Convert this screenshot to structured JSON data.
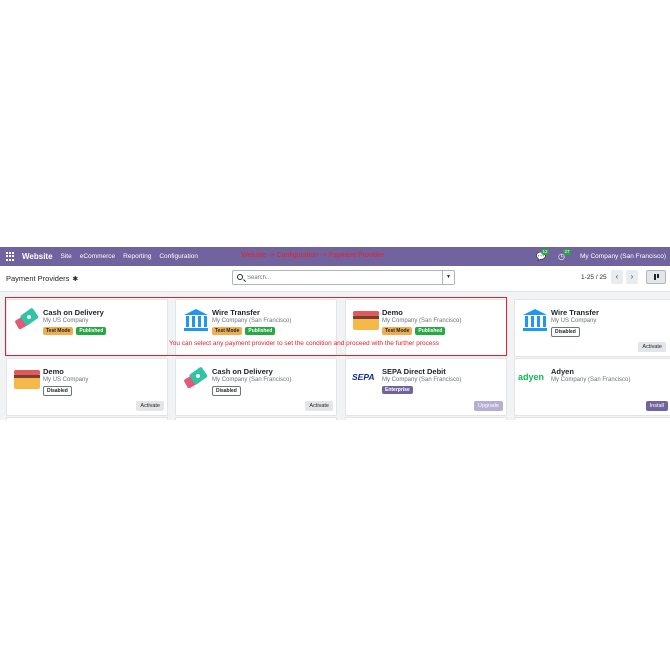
{
  "navbar": {
    "brand": "Website",
    "items": [
      "Site",
      "eCommerce",
      "Reporting",
      "Configuration"
    ],
    "annotation": "Website -> Configuration -> Payment Provider",
    "chat_count": "12",
    "activity_count": "27",
    "company": "My Company (San Francisco)"
  },
  "control": {
    "title": "Payment Providers",
    "search_placeholder": "Search...",
    "pager": "1-25 / 25"
  },
  "annotation": "You can select any payment provider to set the condition and proceed with the further process",
  "cards": [
    {
      "name": "Cash on Delivery",
      "company": "My US Company",
      "tags": [
        "Test Mode",
        "Published"
      ],
      "button": "",
      "logo": "cash-on-delivery"
    },
    {
      "name": "Wire Transfer",
      "company": "My Company (San Francisco)",
      "tags": [
        "Test Mode",
        "Published"
      ],
      "button": "",
      "logo": "bank"
    },
    {
      "name": "Demo",
      "company": "My Company (San Francisco)",
      "tags": [
        "Test Mode",
        "Published"
      ],
      "button": "",
      "logo": "card"
    },
    {
      "name": "Wire Transfer",
      "company": "My US Company",
      "tags": [
        "Disabled"
      ],
      "button": "Activate",
      "logo": "bank"
    },
    {
      "name": "Demo",
      "company": "My US Company",
      "tags": [
        "Disabled"
      ],
      "button": "Activate",
      "logo": "card"
    },
    {
      "name": "Cash on Delivery",
      "company": "My Company (San Francisco)",
      "tags": [
        "Disabled"
      ],
      "button": "Activate",
      "logo": "cash-on-delivery"
    },
    {
      "name": "SEPA Direct Debit",
      "company": "My Company (San Francisco)",
      "tags": [
        "Enterprise"
      ],
      "button": "Upgrade",
      "logo": "sepa"
    },
    {
      "name": "Adyen",
      "company": "My Company (San Francisco)",
      "tags": [],
      "button": "Install",
      "logo": "adyen"
    }
  ],
  "logo_text": {
    "sepa": "SEPA",
    "adyen": "adyen"
  },
  "colors": {
    "brand": "#71639e",
    "annotation": "#e8202a",
    "published": "#28a745",
    "test_mode": "#f0ad4e"
  }
}
